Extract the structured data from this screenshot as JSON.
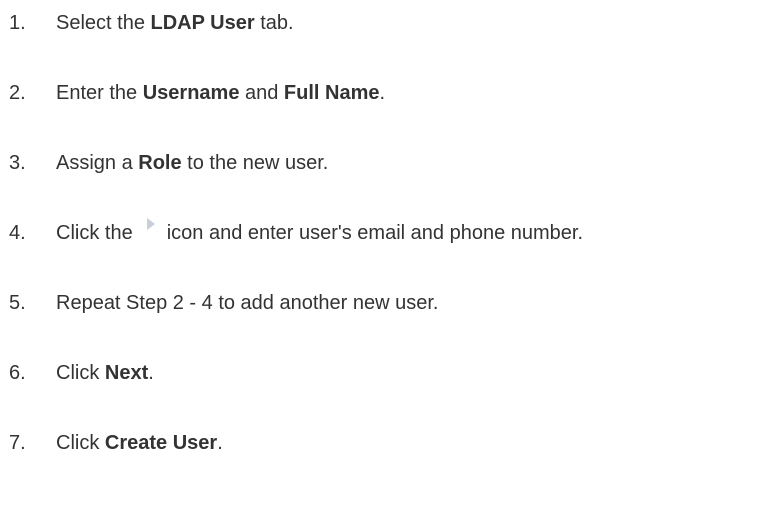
{
  "steps": [
    {
      "num": "1.",
      "parts": [
        {
          "t": "Select the "
        },
        {
          "b": "LDAP User"
        },
        {
          "t": " tab."
        }
      ]
    },
    {
      "num": "2.",
      "parts": [
        {
          "t": "Enter the "
        },
        {
          "b": "Username"
        },
        {
          "t": " and "
        },
        {
          "b": "Full Name"
        },
        {
          "t": "."
        }
      ]
    },
    {
      "num": "3.",
      "parts": [
        {
          "t": "Assign a "
        },
        {
          "b": "Role"
        },
        {
          "t": " to the new user."
        }
      ]
    },
    {
      "num": "4.",
      "parts": [
        {
          "t": "Click the"
        },
        {
          "icon": "play-icon"
        },
        {
          "t": "icon and enter user's email and phone number."
        }
      ]
    },
    {
      "num": "5.",
      "parts": [
        {
          "t": "Repeat Step 2 - 4 to add another new user."
        }
      ]
    },
    {
      "num": "6.",
      "parts": [
        {
          "t": "Click "
        },
        {
          "b": "Next"
        },
        {
          "t": "."
        }
      ]
    },
    {
      "num": "7.",
      "parts": [
        {
          "t": "Click "
        },
        {
          "b": "Create User"
        },
        {
          "t": "."
        }
      ]
    }
  ],
  "colors": {
    "text": "#333333",
    "icon": "#c9cfd8"
  }
}
